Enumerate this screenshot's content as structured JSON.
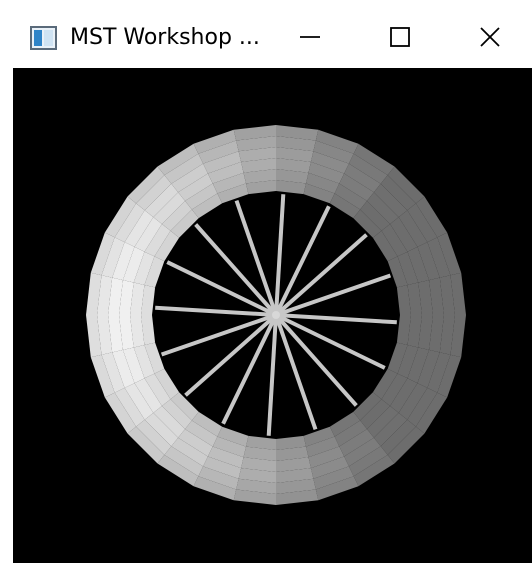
{
  "window": {
    "title": "MST Workshop ..."
  },
  "icons": {
    "app": "application-window-icon",
    "minimize": "minimize-icon",
    "maximize": "maximize-icon",
    "close": "close-icon"
  },
  "scene": {
    "background": "#000000",
    "object": "torus-wheel",
    "spoke_count": 16,
    "spoke_color": "#c7c7c7"
  }
}
